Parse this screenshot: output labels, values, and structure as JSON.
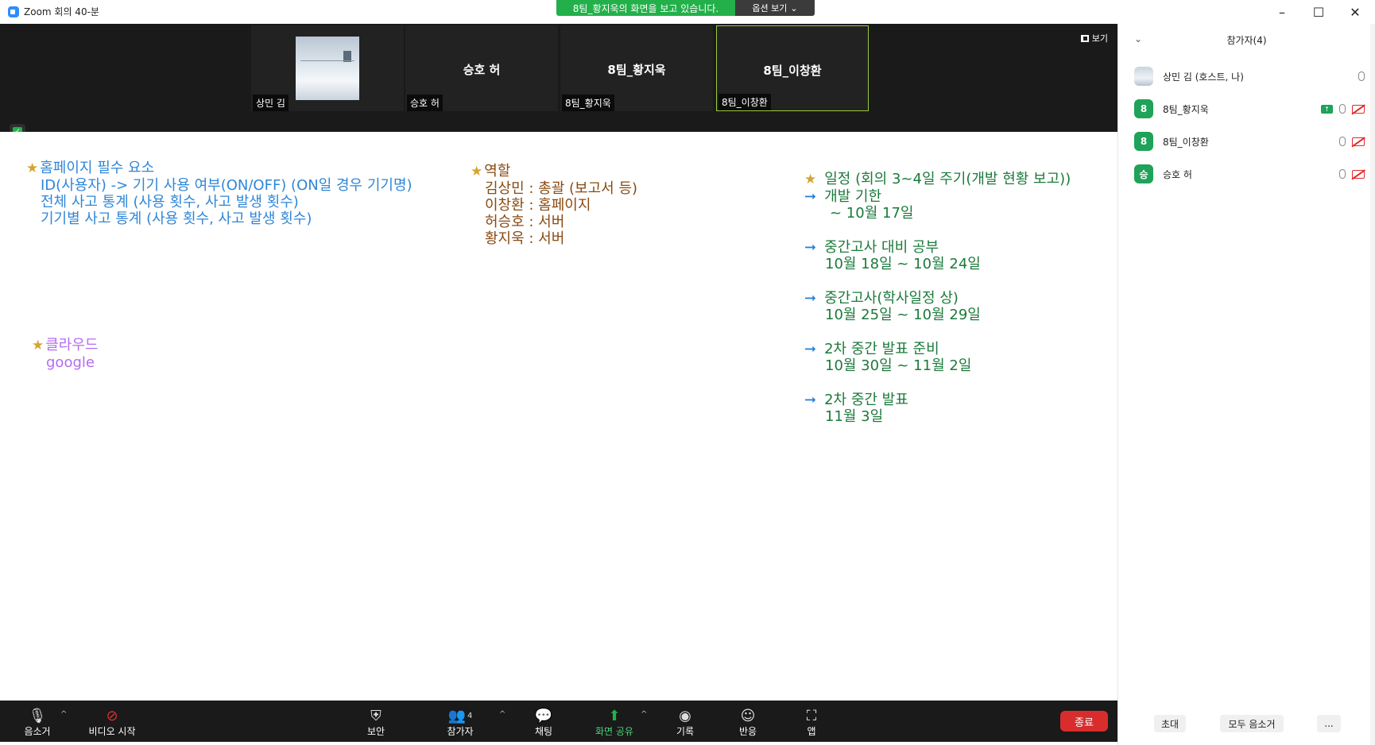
{
  "window": {
    "title": "Zoom 회의 40-분",
    "share_banner": "8팀_황지욱의 화면을 보고 있습니다.",
    "options_label": "옵션 보기"
  },
  "video_strip": {
    "view_label": "보기",
    "tiles": [
      {
        "name": "상민 김",
        "center": ""
      },
      {
        "name": "승호 허",
        "center": "승호 허"
      },
      {
        "name": "8팀_황지욱",
        "center": "8팀_황지욱"
      },
      {
        "name": "8팀_이창환",
        "center": "8팀_이창환"
      }
    ]
  },
  "board": {
    "homepage": {
      "title": "홈페이지 필수 요소",
      "lines": [
        "ID(사용자) -> 기기 사용 여부(ON/OFF) (ON일 경우 기기명)",
        "전체 사고 통계 (사용 횟수, 사고 발생 횟수)",
        "기기별 사고 통계 (사용 횟수, 사고 발생 횟수)"
      ]
    },
    "roles": {
      "title": "역할",
      "lines": [
        "김상민 : 총괄 (보고서 등)",
        "이창환 : 홈페이지",
        "허승호 : 서버",
        "황지욱 : 서버"
      ]
    },
    "cloud": {
      "title": "클라우드",
      "value": "google"
    },
    "schedule": {
      "title": "일정 (회의 3~4일 주기(개발 현황 보고))",
      "items": [
        {
          "label": "개발 기한",
          "date": "~ 10월 17일"
        },
        {
          "label": "중간고사 대비 공부",
          "date": "10월 18일 ~ 10월 24일"
        },
        {
          "label": "중간고사(학사일정 상)",
          "date": "10월 25일 ~ 10월 29일"
        },
        {
          "label": "2차 중간 발표 준비",
          "date": "10월 30일 ~ 11월 2일"
        },
        {
          "label": "2차 중간 발표",
          "date": "11월 3일"
        }
      ]
    }
  },
  "toolbar": {
    "mute": "음소거",
    "video": "비디오 시작",
    "security": "보안",
    "participants": "참가자",
    "participants_count": "4",
    "chat": "채팅",
    "share": "화면 공유",
    "record": "기록",
    "reactions": "반응",
    "apps": "앱",
    "end": "종료"
  },
  "panel": {
    "title": "참가자(4)",
    "participants": [
      {
        "name": "상민 김 (호스트, 나)",
        "initial": ""
      },
      {
        "name": "8팀_황지욱",
        "initial": "8"
      },
      {
        "name": "8팀_이창환",
        "initial": "8"
      },
      {
        "name": "승호 허",
        "initial": "승"
      }
    ],
    "invite": "초대",
    "mute_all": "모두 음소거",
    "more": "..."
  },
  "colors": {
    "share_green": "#23b04a",
    "end_red": "#d92d2d",
    "note_blue": "#2f86d8",
    "note_brown": "#8a4a10",
    "note_green": "#1c7a3b",
    "note_purple": "#b36cf0",
    "star_gold": "#d3a531"
  }
}
